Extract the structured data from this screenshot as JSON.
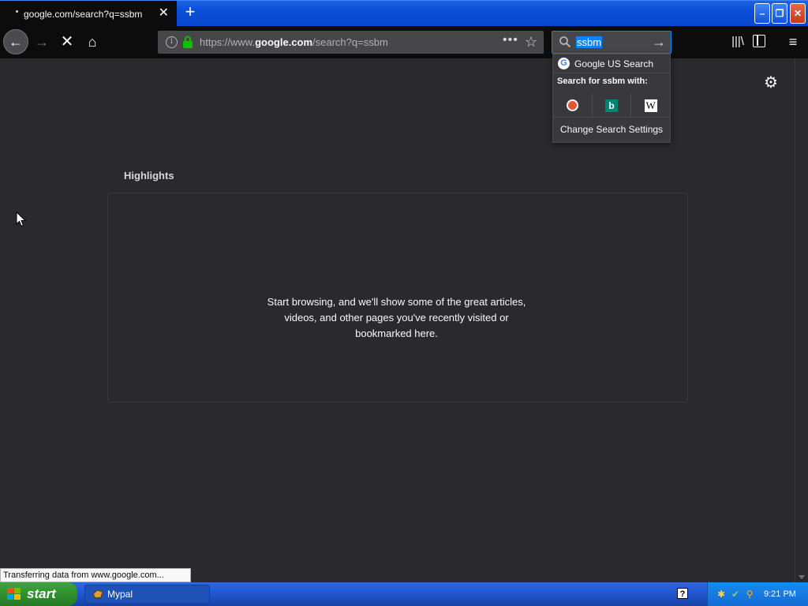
{
  "tab": {
    "title": "google.com/search?q=ssbm",
    "close_glyph": "✕"
  },
  "newtab_glyph": "+",
  "window_controls": {
    "minimize": "–",
    "maximize": "❐",
    "close": "✕"
  },
  "toolbar": {
    "back_glyph": "←",
    "forward_glyph": "→",
    "stop_glyph": "✕",
    "home_glyph": "⌂",
    "url_prefix": "https://www.",
    "url_domain": "google.com",
    "url_path": "/search?q=ssbm",
    "more_glyph": "•••",
    "star_glyph": "☆",
    "library_glyph": "|||\\",
    "menu_glyph": "≡"
  },
  "search": {
    "query": "ssbm",
    "go_glyph": "→",
    "dropdown": {
      "engine_label": "Google US Search",
      "search_with": "Search for ssbm with:",
      "engines": [
        "duckduckgo-icon",
        "bing-icon",
        "wikipedia-icon"
      ],
      "settings_label": "Change Search Settings"
    }
  },
  "newtab": {
    "gear_glyph": "⚙",
    "highlights_title": "Highlights",
    "empty_message": "Start browsing, and we'll show some of the great articles, videos, and other pages you've recently visited or bookmarked here."
  },
  "status_text": "Transferring data from www.google.com...",
  "taskbar": {
    "start_label": "start",
    "task_label": "Mypal",
    "clock": "9:21 PM"
  },
  "colors": {
    "accent": "#0a84ff",
    "content_bg": "#2a2a2e",
    "toolbar_bg": "#0c0c0d"
  }
}
